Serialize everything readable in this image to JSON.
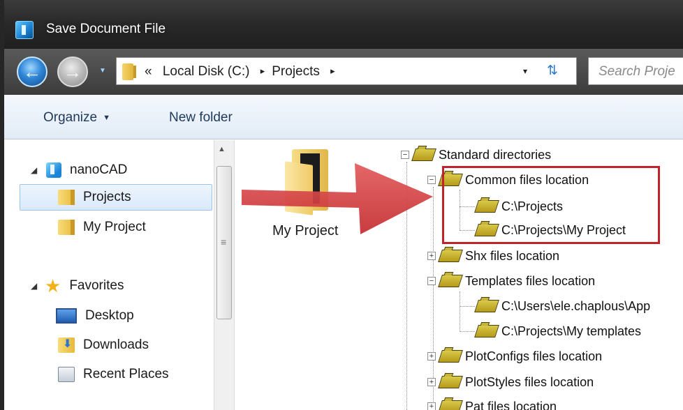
{
  "window": {
    "title": "Save Document File"
  },
  "address_bar": {
    "overflow": "«",
    "segments": [
      "Local Disk (C:)",
      "Projects"
    ],
    "separator": "▸",
    "dropdown": "▾"
  },
  "search": {
    "placeholder": "Search Proje"
  },
  "toolbar": {
    "organize_label": "Organize",
    "organize_caret": "▼",
    "new_folder_label": "New folder"
  },
  "sidebar": {
    "items": [
      {
        "label": "nanoCAD",
        "icon": "nanocad-icon"
      },
      {
        "label": "Projects",
        "icon": "folder-icon"
      },
      {
        "label": "My Project",
        "icon": "folder-icon"
      },
      {
        "label": "Favorites",
        "icon": "star-icon"
      },
      {
        "label": "Desktop",
        "icon": "desktop-icon"
      },
      {
        "label": "Downloads",
        "icon": "downloads-icon"
      },
      {
        "label": "Recent Places",
        "icon": "recent-places-icon"
      }
    ]
  },
  "content": {
    "folder_label": "My Project"
  },
  "tree": {
    "nodes": [
      {
        "label": "Standard directories",
        "expander": "−"
      },
      {
        "label": "Common files location",
        "expander": "−"
      },
      {
        "label": "C:\\Projects",
        "expander": ""
      },
      {
        "label": "C:\\Projects\\My Project",
        "expander": ""
      },
      {
        "label": "Shx files location",
        "expander": "+"
      },
      {
        "label": "Templates files location",
        "expander": "−"
      },
      {
        "label": "C:\\Users\\ele.chaplous\\App",
        "expander": ""
      },
      {
        "label": "C:\\Projects\\My templates",
        "expander": ""
      },
      {
        "label": "PlotConfigs files location",
        "expander": "+"
      },
      {
        "label": "PlotStyles files location",
        "expander": "+"
      },
      {
        "label": "Pat files location",
        "expander": "+"
      }
    ]
  },
  "colors": {
    "highlight_border": "#c0232a",
    "annotation_arrow": "#d33a3d",
    "selection": "#d9e9fb"
  }
}
